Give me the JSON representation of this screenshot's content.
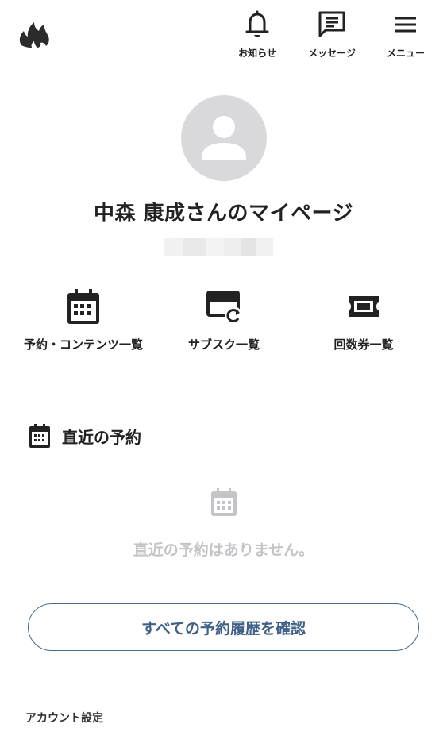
{
  "header": {
    "logo_icon": "flame-logo-icon",
    "nav": [
      {
        "label": "お知らせ",
        "icon": "bell-icon"
      },
      {
        "label": "メッセージ",
        "icon": "message-icon"
      },
      {
        "label": "メニュー",
        "icon": "hamburger-menu-icon"
      }
    ]
  },
  "profile": {
    "avatar_icon": "default-user-avatar-icon",
    "title": "中森 康成さんのマイページ"
  },
  "quick_links": [
    {
      "label": "予約・コンテンツ一覧",
      "icon": "calendar-icon"
    },
    {
      "label": "サブスク一覧",
      "icon": "credit-card-refresh-icon"
    },
    {
      "label": "回数券一覧",
      "icon": "ticket-icon"
    }
  ],
  "recent": {
    "title": "直近の予約",
    "icon": "calendar-icon",
    "empty_message": "直近の予約はありません。",
    "empty_icon": "calendar-icon"
  },
  "history_button": {
    "label": "すべての予約履歴を確認"
  },
  "account": {
    "label": "アカウント設定"
  },
  "colors": {
    "text": "#222222",
    "muted": "#c4c4c8",
    "accent": "#3f5f87",
    "avatar_bg": "#d9d9dc"
  }
}
